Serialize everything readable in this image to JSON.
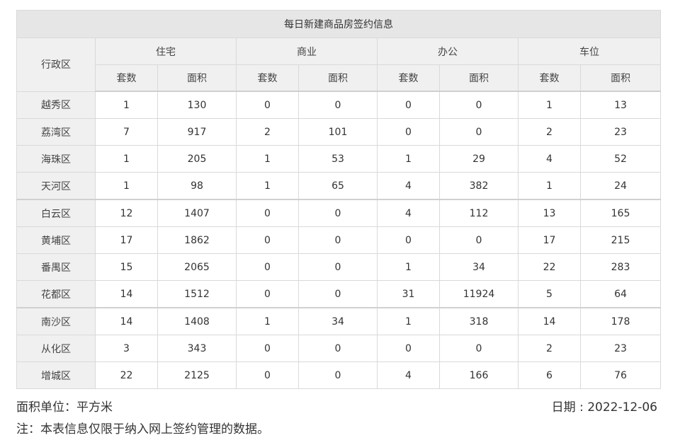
{
  "table": {
    "title": "每日新建商品房签约信息",
    "district_header": "行政区",
    "groups": [
      "住宅",
      "商业",
      "办公",
      "车位"
    ],
    "subheaders": [
      "套数",
      "面积"
    ],
    "rows": [
      {
        "district": "越秀区",
        "values": [
          "1",
          "130",
          "0",
          "0",
          "0",
          "0",
          "1",
          "13"
        ]
      },
      {
        "district": "荔湾区",
        "values": [
          "7",
          "917",
          "2",
          "101",
          "0",
          "0",
          "2",
          "23"
        ]
      },
      {
        "district": "海珠区",
        "values": [
          "1",
          "205",
          "1",
          "53",
          "1",
          "29",
          "4",
          "52"
        ]
      },
      {
        "district": "天河区",
        "values": [
          "1",
          "98",
          "1",
          "65",
          "4",
          "382",
          "1",
          "24"
        ]
      },
      {
        "district": "白云区",
        "values": [
          "12",
          "1407",
          "0",
          "0",
          "4",
          "112",
          "13",
          "165"
        ]
      },
      {
        "district": "黄埔区",
        "values": [
          "17",
          "1862",
          "0",
          "0",
          "0",
          "0",
          "17",
          "215"
        ]
      },
      {
        "district": "番禺区",
        "values": [
          "15",
          "2065",
          "0",
          "0",
          "1",
          "34",
          "22",
          "283"
        ]
      },
      {
        "district": "花都区",
        "values": [
          "14",
          "1512",
          "0",
          "0",
          "31",
          "11924",
          "5",
          "64"
        ]
      },
      {
        "district": "南沙区",
        "values": [
          "14",
          "1408",
          "1",
          "34",
          "1",
          "318",
          "14",
          "178"
        ]
      },
      {
        "district": "从化区",
        "values": [
          "3",
          "343",
          "0",
          "0",
          "0",
          "0",
          "2",
          "23"
        ]
      },
      {
        "district": "增城区",
        "values": [
          "22",
          "2125",
          "0",
          "0",
          "4",
          "166",
          "6",
          "76"
        ]
      }
    ]
  },
  "footer": {
    "unit_text": "面积单位：平方米",
    "date_text": "日期 : 2022-12-06",
    "note_text": "注：本表信息仅限于纳入网上签约管理的数据。"
  }
}
